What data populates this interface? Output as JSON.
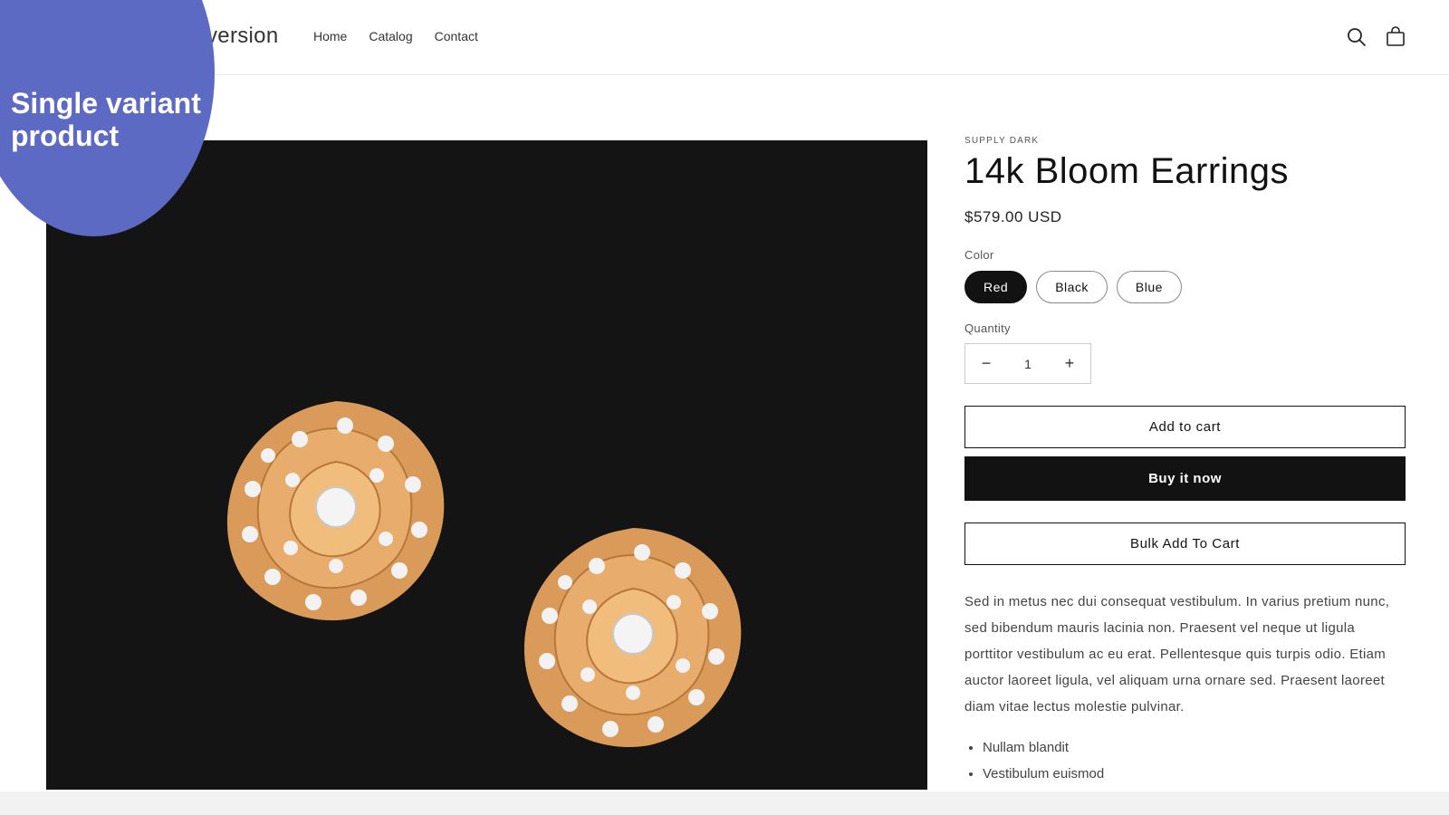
{
  "header": {
    "brand_suffix": "version",
    "nav": [
      "Home",
      "Catalog",
      "Contact"
    ],
    "icons": {
      "search": "search-icon",
      "cart": "cart-icon"
    }
  },
  "badge": {
    "text": "Single variant product",
    "color": "#5c6ac4"
  },
  "product": {
    "vendor": "SUPPLY DARK",
    "title": "14k Bloom Earrings",
    "price": "$579.00 USD",
    "color_label": "Color",
    "colors": [
      "Red",
      "Black",
      "Blue"
    ],
    "selected_color": "Red",
    "quantity_label": "Quantity",
    "quantity": "1",
    "add_to_cart": "Add to cart",
    "buy_now": "Buy it now",
    "bulk_add": "Bulk Add To Cart",
    "description": "Sed in metus nec dui consequat vestibulum. In varius pretium nunc, sed bibendum mauris lacinia non. Praesent vel neque ut ligula porttitor vestibulum ac eu erat. Pellentesque quis turpis odio. Etiam auctor laoreet ligula, vel aliquam urna ornare sed. Praesent laoreet diam vitae lectus molestie pulvinar.",
    "bullets": [
      "Nullam blandit",
      "Vestibulum euismod"
    ]
  },
  "colors": {
    "badge": "#5c6ac4",
    "primary": "#121212",
    "media_bg": "#141414",
    "gold": "#e0a060"
  }
}
